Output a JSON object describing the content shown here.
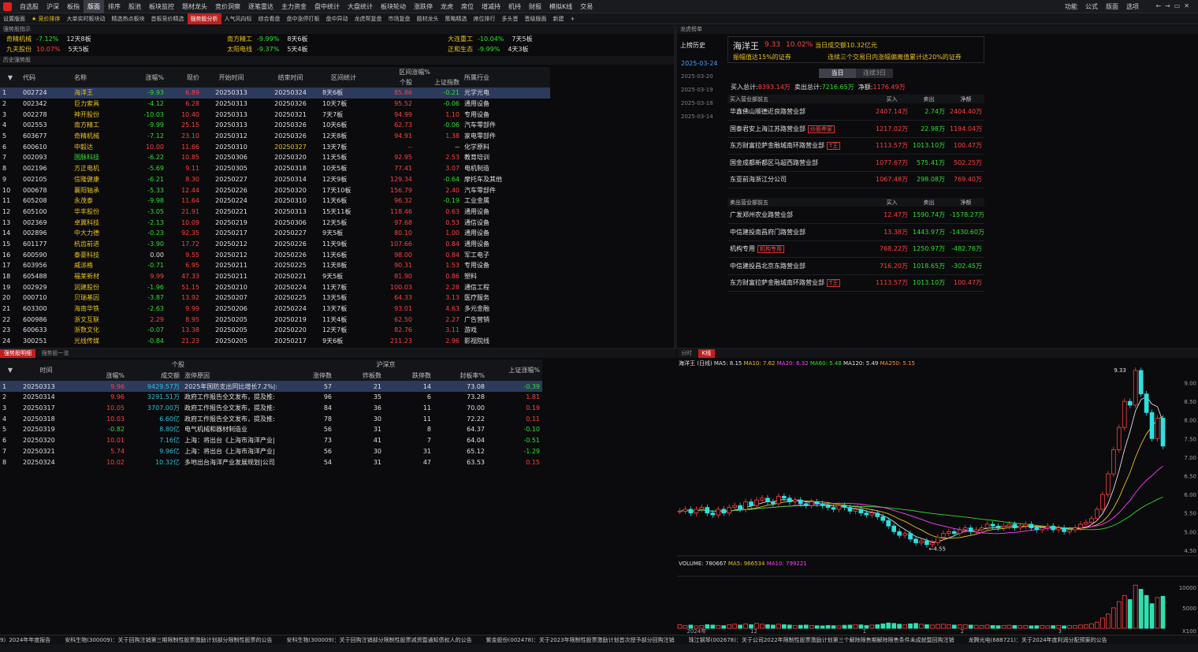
{
  "menu": [
    "自选股",
    "沪深",
    "板指",
    "版面",
    "排序",
    "股池",
    "板块监控",
    "题材龙头",
    "竞价洞察",
    "逐笔雷达",
    "主力资金",
    "盘中统计",
    "大盘统计",
    "板块轮动",
    "涨跌停",
    "龙虎",
    "席位",
    "增减持",
    "机持",
    "财报",
    "模拟K线",
    "交易"
  ],
  "menu_active": 3,
  "right_menu": [
    "功能",
    "公式",
    "版面",
    "选项"
  ],
  "subtabs": [
    "设置版面",
    "★ 竞价排序",
    "大单实时板块动",
    "精选热点板块",
    "首板竞价精选",
    "强势股分析",
    "人气风向标",
    "综合看盘",
    "盘中涨停打板",
    "盘中异动",
    "龙虎帮复盘",
    "市场复盘",
    "题材龙头",
    "策略精选",
    "席位排行",
    "多头晋",
    "晋级版面",
    "新建",
    "+"
  ],
  "subtab_hot": 5,
  "strong_title": "强势股指示",
  "strong_items": [
    {
      "name": "奇精机械",
      "pct": "-7.12%",
      "tag": "12天8板"
    },
    {
      "name": "南方精工",
      "pct": "-9.99%",
      "tag": "8天6板"
    },
    {
      "name": "大连重工",
      "pct": "-10.04%",
      "tag": "7天5板"
    },
    {
      "name": "九夫股份",
      "pct": "10.07%",
      "tag": "5天5板"
    },
    {
      "name": "太阳电线",
      "pct": "-9.37%",
      "tag": "5天4板"
    },
    {
      "name": "正和生态",
      "pct": "-9.99%",
      "tag": "4天3板"
    }
  ],
  "history_title": "历史强势股",
  "history_cols": [
    "代码",
    "名称",
    "涨幅%",
    "现价",
    "开始时间",
    "结束时间",
    "区间统计",
    "个股",
    "上证指数",
    "所属行业"
  ],
  "history_group": "区间涨幅%",
  "history_rows": [
    [
      "1",
      "002724",
      "海洋王",
      "-9.93",
      "6.89",
      "20250313",
      "20250324",
      "8天6板",
      "85.86",
      "-0.21",
      "光学光电"
    ],
    [
      "2",
      "002342",
      "巨力索具",
      "-4.12",
      "6.28",
      "20250313",
      "20250326",
      "10天7板",
      "95.52",
      "-0.06",
      "通用设备"
    ],
    [
      "3",
      "002278",
      "神开股份",
      "-10.03",
      "10.40",
      "20250313",
      "20250321",
      "7天7板",
      "94.99",
      "1.10",
      "专用设备"
    ],
    [
      "4",
      "002553",
      "南方精工",
      "-9.99",
      "25.15",
      "20250313",
      "20250326",
      "10天6板",
      "62.73",
      "-0.06",
      "汽车零部件"
    ],
    [
      "5",
      "603677",
      "奇精机械",
      "-7.12",
      "23.10",
      "20250312",
      "20250326",
      "12天8板",
      "94.91",
      "1.38",
      "家电零部件"
    ],
    [
      "6",
      "600610",
      "中毅达",
      "10.00",
      "11.66",
      "20250310",
      "20250327",
      "13天7板",
      "--",
      "--",
      "化学原料"
    ],
    [
      "7",
      "002093",
      "国脉科技",
      "-6.22",
      "10.85",
      "20250306",
      "20250320",
      "11天5板",
      "92.95",
      "2.53",
      "教育培训"
    ],
    [
      "8",
      "002196",
      "方正电机",
      "-5.69",
      "9.11",
      "20250305",
      "20250318",
      "10天5板",
      "77.41",
      "3.07",
      "电机制造"
    ],
    [
      "9",
      "002105",
      "信隆健康",
      "-6.21",
      "8.30",
      "20250227",
      "20250314",
      "12天9板",
      "129.34",
      "-0.64",
      "摩托车及其他"
    ],
    [
      "10",
      "000678",
      "襄阳轴承",
      "-5.33",
      "12.44",
      "20250226",
      "20250320",
      "17天10板",
      "156.79",
      "2.40",
      "汽车零部件"
    ],
    [
      "11",
      "605208",
      "永茂泰",
      "-9.98",
      "11.64",
      "20250224",
      "20250310",
      "11天6板",
      "96.32",
      "-0.19",
      "工业金属"
    ],
    [
      "12",
      "605100",
      "华丰股份",
      "-3.05",
      "21.91",
      "20250221",
      "20250313",
      "15天11板",
      "118.46",
      "0.63",
      "通用设备"
    ],
    [
      "13",
      "002369",
      "卓翼科技",
      "-2.13",
      "10.09",
      "20250219",
      "20250306",
      "12天5板",
      "97.68",
      "0.53",
      "通信设备"
    ],
    [
      "14",
      "002896",
      "中大力德",
      "-0.23",
      "92.35",
      "20250217",
      "20250227",
      "9天5板",
      "80.10",
      "1.00",
      "通用设备"
    ],
    [
      "15",
      "601177",
      "杭齿前进",
      "-3.90",
      "17.72",
      "20250212",
      "20250226",
      "11天9板",
      "107.66",
      "0.84",
      "通用设备"
    ],
    [
      "16",
      "600590",
      "泰豪科技",
      "0.00",
      "9.55",
      "20250212",
      "20250226",
      "11天6板",
      "98.00",
      "0.84",
      "军工电子"
    ],
    [
      "17",
      "603956",
      "威派格",
      "-0.71",
      "6.95",
      "20250211",
      "20250225",
      "11天8板",
      "90.31",
      "1.53",
      "专用设备"
    ],
    [
      "18",
      "605488",
      "福莱新材",
      "9.99",
      "47.33",
      "20250211",
      "20250221",
      "9天5板",
      "81.90",
      "0.86",
      "塑料"
    ],
    [
      "19",
      "002929",
      "润建股份",
      "-1.96",
      "51.15",
      "20250210",
      "20250224",
      "11天7板",
      "100.03",
      "2.28",
      "通信工程"
    ],
    [
      "20",
      "000710",
      "贝瑞基因",
      "-3.87",
      "13.92",
      "20250207",
      "20250225",
      "13天5板",
      "64.33",
      "3.13",
      "医疗服务"
    ],
    [
      "21",
      "603300",
      "海南华铁",
      "-2.63",
      "9.99",
      "20250206",
      "20250224",
      "13天7板",
      "93.01",
      "4.63",
      "多元金融"
    ],
    [
      "22",
      "600986",
      "浙文互联",
      "2.29",
      "8.95",
      "20250205",
      "20250219",
      "11天4板",
      "62.50",
      "2.27",
      "广告营销"
    ],
    [
      "23",
      "600633",
      "浙数文化",
      "-0.07",
      "13.38",
      "20250205",
      "20250220",
      "12天7板",
      "82.76",
      "3.11",
      "游戏"
    ],
    [
      "24",
      "300251",
      "光线传媒",
      "-0.84",
      "21.23",
      "20250205",
      "20250217",
      "9天6板",
      "211.23",
      "2.96",
      "影视院线"
    ]
  ],
  "lhb_title": "龙虎榜单",
  "lhb_tabs": [
    "上榜历史"
  ],
  "lhb_dates": [
    "2025-03-24",
    "2025-03-20",
    "2025-03-19",
    "2025-03-18",
    "2025-03-14"
  ],
  "lhb_stock": {
    "name": "海洋王",
    "price": "9.33",
    "pct": "10.02%",
    "amount": "当日成交额10.32亿元",
    "reason1": "振幅值达15%的证券",
    "reason2": "连续三个交易日内涨幅偏离值累计达20%的证券"
  },
  "lhb_toggle": [
    "当日",
    "连续3日"
  ],
  "lhb_totals": {
    "buy_label": "买入总计:",
    "buy": "8393.14万",
    "sell_label": "卖出总计:",
    "sell": "7216.65万",
    "net_label": "净额:",
    "net": "1176.49万"
  },
  "lhb_buy_title": "买入营业部前五",
  "lhb_sell_title": "卖出营业部前五",
  "lhb_cols": [
    "买入",
    "卖出",
    "净额"
  ],
  "lhb_buy": [
    {
      "name": "华鑫佛山顺德近良路营业部",
      "tag": "",
      "b": "2407.14万",
      "s": "2.74万",
      "n": "2404.40万"
    },
    {
      "name": "国泰君安上海江苏路营业部",
      "tag": "炒股养家",
      "b": "1217.02万",
      "s": "22.98万",
      "n": "1194.04万"
    },
    {
      "name": "东方财富拉萨金融城南环路营业部",
      "tag": "T王",
      "b": "1113.57万",
      "s": "1013.10万",
      "n": "100.47万"
    },
    {
      "name": "国金成都新都区马超西路营业部",
      "tag": "",
      "b": "1077.67万",
      "s": "575.41万",
      "n": "502.25万"
    },
    {
      "name": "东亚前海浙江分公司",
      "tag": "",
      "b": "1067.48万",
      "s": "298.08万",
      "n": "769.40万"
    }
  ],
  "lhb_sell": [
    {
      "name": "广发郑州农业路营业部",
      "tag": "",
      "b": "12.47万",
      "s": "1590.74万",
      "n": "-1578.27万"
    },
    {
      "name": "中信建投南昌府门路营业部",
      "tag": "",
      "b": "13.38万",
      "s": "1443.97万",
      "n": "-1430.60万"
    },
    {
      "name": "机构专用",
      "tag": "机构专用",
      "b": "768.22万",
      "s": "1250.97万",
      "n": "-482.76万"
    },
    {
      "name": "中信建投昌北京东路营业部",
      "tag": "",
      "b": "716.20万",
      "s": "1018.65万",
      "n": "-302.45万"
    },
    {
      "name": "东方财富拉萨金融城南环路营业部",
      "tag": "T王",
      "b": "1113.57万",
      "s": "1013.10万",
      "n": "100.47万"
    }
  ],
  "bottom_tabs": [
    "强势股明细",
    "强势股一览"
  ],
  "detail_group1": "个股",
  "detail_group2": "沪深京",
  "detail_cols": [
    "时间",
    "涨幅%",
    "成交额",
    "涨停原因",
    "涨停数",
    "炸板数",
    "跌停数",
    "封板率%",
    "上证涨幅%"
  ],
  "detail_rows": [
    [
      "1",
      "20250313",
      "9.96",
      "9429.57万",
      "2025年国防支出同比增长7.2%|:",
      "57",
      "21",
      "14",
      "73.08",
      "-0.39"
    ],
    [
      "2",
      "20250314",
      "9.96",
      "3291.51万",
      "政府工作报告全文发布，提及推:",
      "96",
      "35",
      "6",
      "73.28",
      "1.81"
    ],
    [
      "3",
      "20250317",
      "10.05",
      "3707.00万",
      "政府工作报告全文发布，提及推:",
      "84",
      "36",
      "11",
      "70.00",
      "0.19"
    ],
    [
      "4",
      "20250318",
      "10.03",
      "6.60亿",
      "政府工作报告全文发布，提及推:",
      "78",
      "30",
      "11",
      "72.22",
      "0.11"
    ],
    [
      "5",
      "20250319",
      "-0.82",
      "8.80亿",
      "电气机械和器材制造业",
      "56",
      "31",
      "8",
      "64.37",
      "-0.10"
    ],
    [
      "6",
      "20250320",
      "10.01",
      "7.16亿",
      "上海：将出台《上海市海洋产业|",
      "73",
      "41",
      "7",
      "64.04",
      "-0.51"
    ],
    [
      "7",
      "20250321",
      "5.74",
      "9.96亿",
      "上海：将出台《上海市海洋产业|",
      "56",
      "30",
      "31",
      "65.12",
      "-1.29"
    ],
    [
      "8",
      "20250324",
      "10.02",
      "10.32亿",
      "多地出台海洋产业发展规划|公司",
      "54",
      "31",
      "47",
      "63.53",
      "0.15"
    ]
  ],
  "chart_tabs": [
    "分时",
    "K线"
  ],
  "chart_legend": {
    "title": "海洋王 (日线)",
    "ma5": "MA5: 8.15",
    "ma10": "MA10: 7.62",
    "ma20": "MA20: 6.32",
    "ma60": "MA60: 5.48",
    "ma120": "MA120: 5.49",
    "ma250": "MA250: 5.15"
  },
  "vol_legend": {
    "vol": "VOLUME: 780667",
    "ma5": "MA5: 966534",
    "ma10": "MA10: 799221"
  },
  "chart_data": {
    "type": "candlestick",
    "price_ticks": [
      "9.00",
      "8.50",
      "8.00",
      "7.50",
      "7.00",
      "6.50",
      "6.00",
      "5.50",
      "5.00",
      "4.50"
    ],
    "ylim": [
      4.35,
      9.35
    ],
    "high_label": "9.33",
    "low_label": "4.55",
    "vol_ticks": [
      "10000",
      "5000"
    ],
    "vol_unit": "X100",
    "x_labels": [
      "2024年",
      "12",
      "1",
      "2",
      "3"
    ],
    "closes": [
      5.55,
      5.6,
      5.5,
      5.6,
      5.65,
      5.5,
      5.45,
      5.6,
      5.5,
      5.65,
      5.7,
      5.6,
      5.8,
      5.7,
      5.85,
      5.9,
      5.8,
      5.75,
      5.95,
      5.9,
      5.8,
      5.85,
      5.75,
      5.7,
      5.8,
      5.75,
      5.7,
      5.65,
      5.6,
      5.7,
      5.65,
      5.55,
      5.6,
      5.5,
      5.45,
      5.5,
      5.4,
      5.3,
      5.15,
      5.0,
      4.9,
      4.95,
      4.8,
      4.7,
      4.75,
      4.65,
      4.7,
      4.85,
      4.95,
      5.0,
      4.95,
      5.05,
      5.1,
      5.0,
      5.05,
      5.1,
      5.2,
      5.15,
      5.1,
      5.15,
      5.2,
      5.1,
      5.15,
      5.2,
      5.1,
      5.05,
      5.1,
      5.15,
      5.05,
      5.1,
      5.0,
      5.05,
      5.1,
      5.2,
      5.25,
      5.35,
      5.6,
      6.0,
      6.55,
      7.2,
      7.8,
      8.5,
      8.4,
      9.33,
      8.7,
      8.2,
      7.5,
      8.05,
      7.3
    ],
    "volumes": [
      900,
      700,
      800,
      600,
      700,
      900,
      800,
      700,
      650,
      900,
      1000,
      800,
      1100,
      900,
      1200,
      1000,
      900,
      800,
      1000,
      900,
      800,
      700,
      750,
      800,
      700,
      650,
      600,
      700,
      650,
      600,
      750,
      800,
      900,
      850,
      700,
      800,
      900,
      1100,
      1300,
      1200,
      1000,
      900,
      1100,
      1200,
      1000,
      900,
      800,
      950,
      1000,
      900,
      800,
      850,
      900,
      800,
      750,
      700,
      800,
      700,
      650,
      700,
      750,
      700,
      650,
      700,
      600,
      650,
      700,
      600,
      650,
      700,
      600,
      650,
      700,
      800,
      900,
      1100,
      1500,
      2500,
      3500,
      5000,
      6500,
      8000,
      7000,
      10500,
      9500,
      8000,
      6000,
      7500,
      7800
    ]
  },
  "ticker": [
    "9）2024年年度报告",
    "安科生物(300009)：关于回购注销第三期限制性股票激励计划部分限制性股票的公告",
    "安科生物(300009)：关于回购注销部分限制性股票减资暨通知债权人的公告",
    "紫金股份(002478)：关于2023年限制性股票激励计划首次授予部分回购注销",
    "珠江钢琴(002678)：关于公司2022年限制性股票激励计划第三个解除限售期解除限售条件未成就暨回购注销",
    "龙腾光电(688721)：关于2024年度利润分配预案的公告"
  ]
}
